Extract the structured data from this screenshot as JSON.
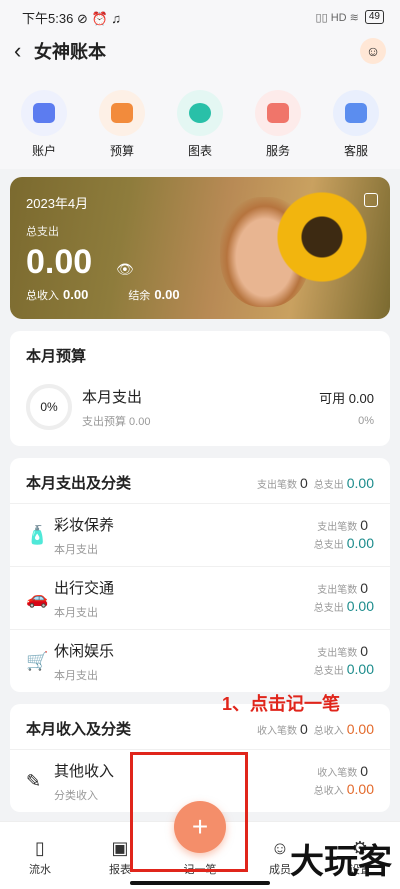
{
  "status": {
    "time": "下午5:36",
    "icons": "⊘ ⏰ ♫",
    "right": "▯▯ HD ≋",
    "battery": "49"
  },
  "header": {
    "back": "‹",
    "title": "女神账本",
    "avatar": "☺"
  },
  "quick": [
    {
      "label": "账户",
      "icon": "account-icon",
      "color": "#5c7cf0",
      "bg": "#eef1fd"
    },
    {
      "label": "预算",
      "icon": "budget-icon",
      "color": "#f28b3c",
      "bg": "#fdf0e6"
    },
    {
      "label": "图表",
      "icon": "chart-icon",
      "color": "#29c0a8",
      "bg": "#e4f7f3"
    },
    {
      "label": "服务",
      "icon": "service-icon",
      "color": "#f0756a",
      "bg": "#fdebea"
    },
    {
      "label": "客服",
      "icon": "support-icon",
      "color": "#5b8def",
      "bg": "#e9effd"
    }
  ],
  "hero": {
    "date": "2023年4月",
    "label": "总支出",
    "amount": "0.00",
    "income_label": "总收入",
    "income": "0.00",
    "balance_label": "结余",
    "balance": "0.00"
  },
  "budget": {
    "title": "本月预算",
    "percent": "0%",
    "name": "本月支出",
    "sub": "支出预算 0.00",
    "available": "可用 0.00",
    "pct2": "0%"
  },
  "expense": {
    "title": "本月支出及分类",
    "count_label": "支出笔数",
    "count": "0",
    "total_label": "总支出",
    "total": "0.00",
    "rows": [
      {
        "name": "彩妆保养",
        "sub": "本月支出",
        "count_label": "支出笔数",
        "count": "0",
        "total_label": "总支出",
        "total": "0.00",
        "icon": "🧴"
      },
      {
        "name": "出行交通",
        "sub": "本月支出",
        "count_label": "支出笔数",
        "count": "0",
        "total_label": "总支出",
        "total": "0.00",
        "icon": "🚗"
      },
      {
        "name": "休闲娱乐",
        "sub": "本月支出",
        "count_label": "支出笔数",
        "count": "0",
        "total_label": "总支出",
        "total": "0.00",
        "icon": "🛒"
      }
    ]
  },
  "income": {
    "title": "本月收入及分类",
    "count_label": "收入笔数",
    "count": "0",
    "total_label": "总收入",
    "total": "0.00",
    "rows": [
      {
        "name": "其他收入",
        "sub": "分类收入",
        "count_label": "收入笔数",
        "count": "0",
        "total_label": "总收入",
        "total": "0.00",
        "icon": "✎"
      }
    ]
  },
  "annotation": "1、点击记一笔",
  "tabs": [
    {
      "label": "流水",
      "icon": "▯"
    },
    {
      "label": "报表",
      "icon": "▣"
    },
    {
      "label": "记一笔",
      "icon": ""
    },
    {
      "label": "成员",
      "icon": "☺"
    },
    {
      "label": "设置",
      "icon": "⚙"
    }
  ],
  "fab": "+",
  "watermark": "大玩客"
}
